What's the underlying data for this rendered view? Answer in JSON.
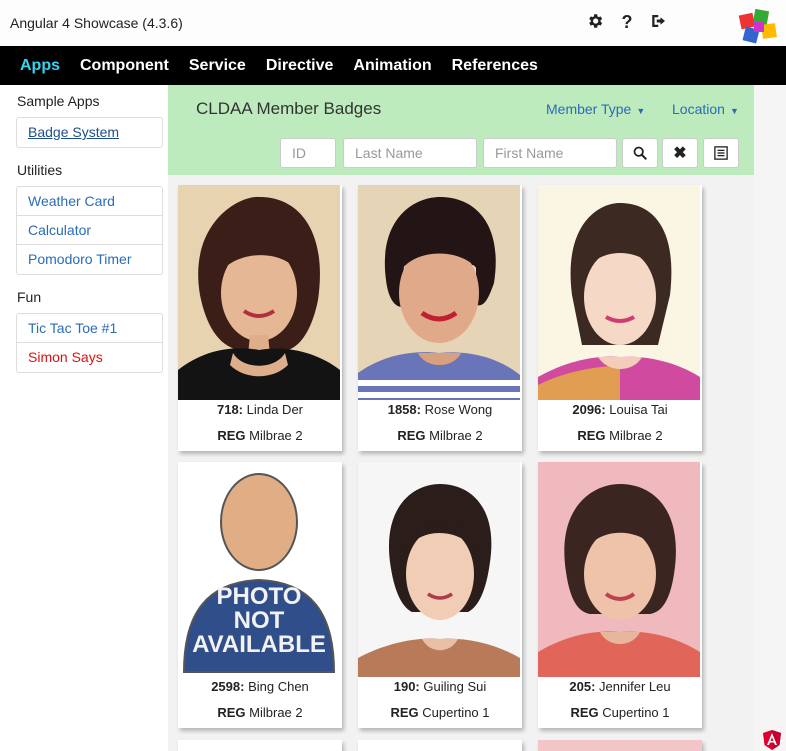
{
  "window": {
    "title": "Angular 4 Showcase (4.3.6)"
  },
  "toolbar_icons": [
    "gear-icon",
    "help-icon",
    "sign-out-icon"
  ],
  "nav": {
    "items": [
      {
        "label": "Apps",
        "active": true
      },
      {
        "label": "Component",
        "active": false
      },
      {
        "label": "Service",
        "active": false
      },
      {
        "label": "Directive",
        "active": false
      },
      {
        "label": "Animation",
        "active": false
      },
      {
        "label": "References",
        "active": false
      }
    ]
  },
  "sidebar": {
    "groups": [
      {
        "title": "Sample Apps",
        "items": [
          "Badge System"
        ]
      },
      {
        "title": "Utilities",
        "items": [
          "Weather Card",
          "Calculator",
          "Pomodoro Timer"
        ]
      },
      {
        "title": "Fun",
        "items": [
          "Tic Tac Toe #1",
          "Simon Says"
        ]
      }
    ]
  },
  "panel": {
    "title": "CLDAA Member Badges",
    "member_type_label": "Member Type",
    "location_label": "Location",
    "id_placeholder": "ID",
    "last_name_placeholder": "Last Name",
    "first_name_placeholder": "First Name"
  },
  "badges": [
    {
      "id": "718:",
      "name": "Linda Der",
      "type": "REG",
      "location": "Milbrae 2"
    },
    {
      "id": "1858:",
      "name": "Rose Wong",
      "type": "REG",
      "location": "Milbrae 2"
    },
    {
      "id": "2096:",
      "name": "Louisa Tai",
      "type": "REG",
      "location": "Milbrae 2"
    },
    {
      "id": "2598:",
      "name": "Bing Chen",
      "type": "REG",
      "location": "Milbrae 2"
    },
    {
      "id": "190:",
      "name": "Guiling Sui",
      "type": "REG",
      "location": "Cupertino 1"
    },
    {
      "id": "205:",
      "name": "Jennifer Leu",
      "type": "REG",
      "location": "Cupertino 1"
    }
  ],
  "photo_placeholder": {
    "line1": "PHOTO",
    "line2": "NOT",
    "line3": "AVAILABLE"
  },
  "colors": {
    "nav_active": "#35d3f0",
    "panel_bg": "#bdebbd",
    "link": "#2a6cb6",
    "alert_link": "#dd1111"
  }
}
